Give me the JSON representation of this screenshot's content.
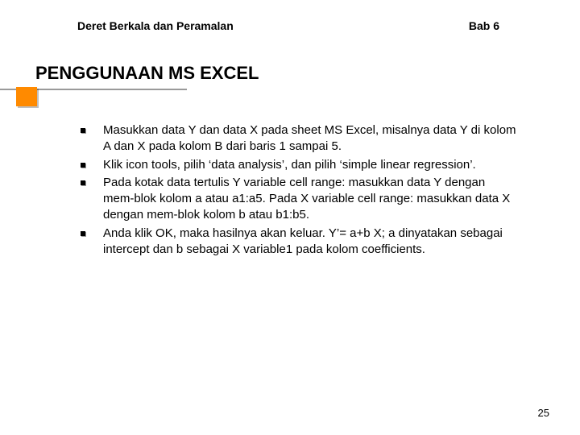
{
  "header": {
    "left": "Deret Berkala dan Peramalan",
    "right": "Bab 6"
  },
  "title": "PENGGUNAAN MS EXCEL",
  "bullets": [
    "Masukkan data Y dan data X pada sheet MS Excel, misalnya data Y di kolom A dan X pada kolom B dari baris 1 sampai 5.",
    "Klik icon tools, pilih ‘data analysis’, dan pilih ‘simple linear regression’.",
    "Pada kotak data tertulis Y variable cell range: masukkan data Y dengan mem-blok kolom a atau a1:a5. Pada X variable cell range: masukkan data X dengan mem-blok kolom b atau b1:b5.",
    "Anda klik OK, maka hasilnya akan keluar. Y’= a+b X; a dinyatakan sebagai intercept dan b sebagai X variable1 pada kolom coefficients."
  ],
  "page_number": "25"
}
